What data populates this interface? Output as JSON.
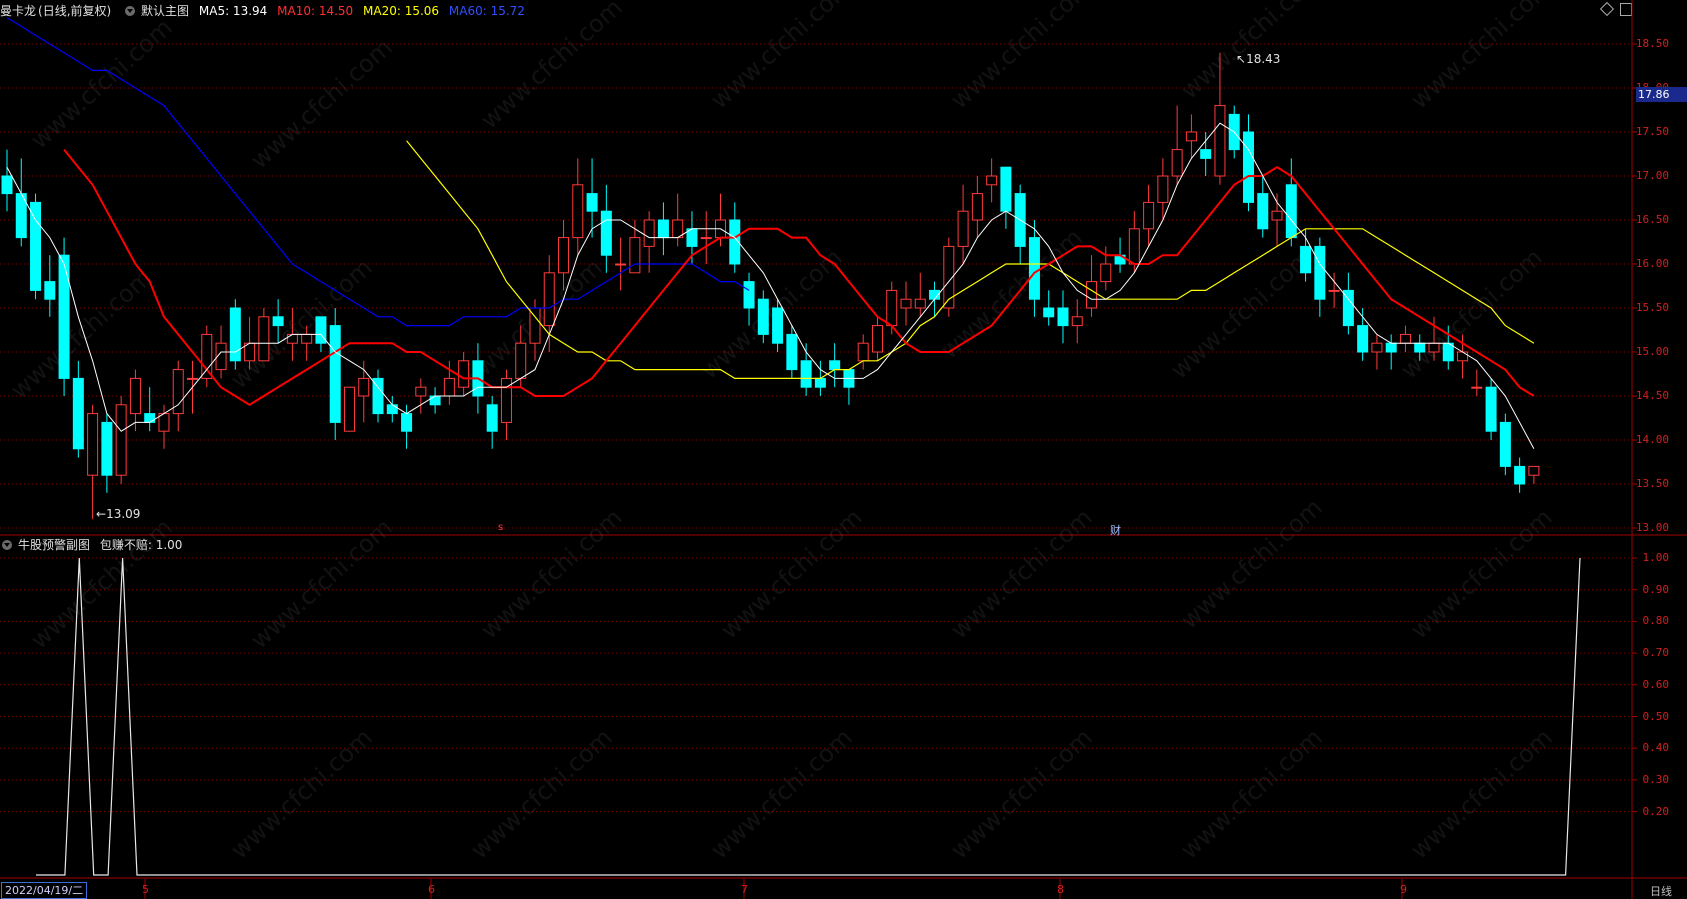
{
  "main_header": {
    "stock_name": "曼卡龙",
    "mode": "(日线,前复权)",
    "template": "默认主图",
    "ma5": "MA5: 13.94",
    "ma10": "MA10: 14.50",
    "ma20": "MA20: 15.06",
    "ma60": "MA60: 15.72"
  },
  "sub_header": {
    "indicator": "牛股预警副图",
    "value": "包赚不赔: 1.00"
  },
  "colors": {
    "up": "#ff3b3b",
    "down": "#00ffff",
    "ma5": "#ffffff",
    "ma10": "#ff0000",
    "ma20": "#ffff00",
    "ma60": "#0000ff",
    "grid": "#7a0000"
  },
  "price_axis": [
    "18.50",
    "18.00",
    "17.50",
    "17.00",
    "16.50",
    "16.00",
    "15.50",
    "15.00",
    "14.50",
    "14.00",
    "13.50",
    "13.00"
  ],
  "current_price": "17.86",
  "indicator_axis": [
    "1.00",
    "0.90",
    "0.80",
    "0.70",
    "0.60",
    "0.50",
    "0.40",
    "0.30",
    "0.20"
  ],
  "annotations": {
    "high": "18.43",
    "low": "13.09"
  },
  "markers": {
    "s": "s",
    "cai": "财"
  },
  "time_axis": {
    "start_date": "2022/04/19/二",
    "months": [
      "5",
      "6",
      "7",
      "8",
      "9"
    ],
    "period": "日线"
  },
  "watermark": "www.cfchi.com",
  "chart_data": [
    {
      "type": "candlestick",
      "title": "曼卡龙 (日线,前复权)",
      "ylim": [
        12.9,
        18.7
      ],
      "candles": [
        [
          17.0,
          16.8,
          17.3,
          16.6
        ],
        [
          16.8,
          16.3,
          17.2,
          16.2
        ],
        [
          16.7,
          15.7,
          16.8,
          15.6
        ],
        [
          15.8,
          15.6,
          16.1,
          15.4
        ],
        [
          16.1,
          14.7,
          16.3,
          14.5
        ],
        [
          14.7,
          13.9,
          14.9,
          13.8
        ],
        [
          13.6,
          14.3,
          14.4,
          13.1
        ],
        [
          14.2,
          13.6,
          14.3,
          13.4
        ],
        [
          13.6,
          14.4,
          14.5,
          13.5
        ],
        [
          14.3,
          14.7,
          14.8,
          14.1
        ],
        [
          14.3,
          14.2,
          14.6,
          14.1
        ],
        [
          14.1,
          14.3,
          14.4,
          13.9
        ],
        [
          14.3,
          14.8,
          14.9,
          14.1
        ],
        [
          14.7,
          14.7,
          14.9,
          14.3
        ],
        [
          14.7,
          15.2,
          15.3,
          14.6
        ],
        [
          14.8,
          15.1,
          15.3,
          14.7
        ],
        [
          15.5,
          14.9,
          15.6,
          14.8
        ],
        [
          14.9,
          15.1,
          15.4,
          14.8
        ],
        [
          14.9,
          15.4,
          15.5,
          14.9
        ],
        [
          15.4,
          15.3,
          15.6,
          15.1
        ],
        [
          15.1,
          15.2,
          15.5,
          14.9
        ],
        [
          15.1,
          15.2,
          15.3,
          14.9
        ],
        [
          15.4,
          15.1,
          15.4,
          15.0
        ],
        [
          15.3,
          14.2,
          15.5,
          14.0
        ],
        [
          14.1,
          14.6,
          14.6,
          14.1
        ],
        [
          14.5,
          14.7,
          14.9,
          14.2
        ],
        [
          14.7,
          14.3,
          14.8,
          14.2
        ],
        [
          14.4,
          14.3,
          14.5,
          14.2
        ],
        [
          14.3,
          14.1,
          14.4,
          13.9
        ],
        [
          14.5,
          14.6,
          14.7,
          14.3
        ],
        [
          14.5,
          14.4,
          14.6,
          14.3
        ],
        [
          14.5,
          14.7,
          14.9,
          14.4
        ],
        [
          14.6,
          14.9,
          15.0,
          14.5
        ],
        [
          14.9,
          14.5,
          15.1,
          14.3
        ],
        [
          14.4,
          14.1,
          14.5,
          13.9
        ],
        [
          14.2,
          14.7,
          14.8,
          14.0
        ],
        [
          14.7,
          15.1,
          15.3,
          14.6
        ],
        [
          15.1,
          15.5,
          15.6,
          14.9
        ],
        [
          15.3,
          15.9,
          16.1,
          15.0
        ],
        [
          15.9,
          16.3,
          16.5,
          15.7
        ],
        [
          16.3,
          16.9,
          17.2,
          16.1
        ],
        [
          16.8,
          16.6,
          17.2,
          16.3
        ],
        [
          16.6,
          16.1,
          16.9,
          15.9
        ],
        [
          16.0,
          16.0,
          16.3,
          15.7
        ],
        [
          15.9,
          16.3,
          16.5,
          15.9
        ],
        [
          16.2,
          16.5,
          16.6,
          15.9
        ],
        [
          16.5,
          16.3,
          16.7,
          16.1
        ],
        [
          16.3,
          16.5,
          16.8,
          16.2
        ],
        [
          16.4,
          16.2,
          16.6,
          16.0
        ],
        [
          16.3,
          16.3,
          16.6,
          16.0
        ],
        [
          16.3,
          16.5,
          16.8,
          16.2
        ],
        [
          16.5,
          16.0,
          16.7,
          15.9
        ],
        [
          15.8,
          15.5,
          15.9,
          15.3
        ],
        [
          15.6,
          15.2,
          15.7,
          15.1
        ],
        [
          15.5,
          15.1,
          15.6,
          15.0
        ],
        [
          15.2,
          14.8,
          15.3,
          14.7
        ],
        [
          14.9,
          14.6,
          15.1,
          14.5
        ],
        [
          14.7,
          14.6,
          14.9,
          14.5
        ],
        [
          14.9,
          14.8,
          15.1,
          14.6
        ],
        [
          14.8,
          14.6,
          14.8,
          14.4
        ],
        [
          14.9,
          15.1,
          15.2,
          14.8
        ],
        [
          15.0,
          15.3,
          15.4,
          14.9
        ],
        [
          15.3,
          15.7,
          15.8,
          15.2
        ],
        [
          15.5,
          15.6,
          15.8,
          15.3
        ],
        [
          15.5,
          15.6,
          15.9,
          15.4
        ],
        [
          15.7,
          15.6,
          15.8,
          15.4
        ],
        [
          15.5,
          16.2,
          16.3,
          15.4
        ],
        [
          16.2,
          16.6,
          16.9,
          16.0
        ],
        [
          16.5,
          16.8,
          17.0,
          16.3
        ],
        [
          16.9,
          17.0,
          17.2,
          16.7
        ],
        [
          17.1,
          16.6,
          17.1,
          16.4
        ],
        [
          16.8,
          16.2,
          16.9,
          16.0
        ],
        [
          16.3,
          15.6,
          16.5,
          15.4
        ],
        [
          15.5,
          15.4,
          15.7,
          15.3
        ],
        [
          15.5,
          15.3,
          15.7,
          15.1
        ],
        [
          15.3,
          15.4,
          15.6,
          15.1
        ],
        [
          15.5,
          15.8,
          16.1,
          15.4
        ],
        [
          15.8,
          16.0,
          16.2,
          15.7
        ],
        [
          16.1,
          16.0,
          16.3,
          15.9
        ],
        [
          16.0,
          16.4,
          16.6,
          15.9
        ],
        [
          16.4,
          16.7,
          16.9,
          16.2
        ],
        [
          16.7,
          17.0,
          17.2,
          16.5
        ],
        [
          17.0,
          17.3,
          17.8,
          16.9
        ],
        [
          17.4,
          17.5,
          17.7,
          17.2
        ],
        [
          17.3,
          17.2,
          17.5,
          17.0
        ],
        [
          17.0,
          17.8,
          18.4,
          16.9
        ],
        [
          17.7,
          17.3,
          17.8,
          17.2
        ],
        [
          17.5,
          16.7,
          17.7,
          16.6
        ],
        [
          16.8,
          16.4,
          17.0,
          16.3
        ],
        [
          16.5,
          16.6,
          16.8,
          16.2
        ],
        [
          16.9,
          16.3,
          17.2,
          16.2
        ],
        [
          16.2,
          15.9,
          16.4,
          15.8
        ],
        [
          16.2,
          15.6,
          16.3,
          15.4
        ],
        [
          15.7,
          15.7,
          15.9,
          15.5
        ],
        [
          15.7,
          15.3,
          15.9,
          15.2
        ],
        [
          15.3,
          15.0,
          15.5,
          14.9
        ],
        [
          15.0,
          15.1,
          15.2,
          14.8
        ],
        [
          15.1,
          15.0,
          15.2,
          14.8
        ],
        [
          15.1,
          15.2,
          15.3,
          15.0
        ],
        [
          15.1,
          15.0,
          15.2,
          14.9
        ],
        [
          15.0,
          15.1,
          15.4,
          14.9
        ],
        [
          15.1,
          14.9,
          15.3,
          14.8
        ],
        [
          14.9,
          15.0,
          15.2,
          14.7
        ],
        [
          14.6,
          14.6,
          14.8,
          14.5
        ],
        [
          14.6,
          14.1,
          14.7,
          14.0
        ],
        [
          14.2,
          13.7,
          14.3,
          13.6
        ],
        [
          13.7,
          13.5,
          13.8,
          13.4
        ],
        [
          13.6,
          13.7,
          13.7,
          13.5
        ]
      ],
      "ma5": [
        17.1,
        16.8,
        16.5,
        16.3,
        16.0,
        15.4,
        14.9,
        14.3,
        14.1,
        14.2,
        14.2,
        14.3,
        14.4,
        14.6,
        14.8,
        15.0,
        15.0,
        15.1,
        15.1,
        15.1,
        15.2,
        15.2,
        15.2,
        15.0,
        14.9,
        14.8,
        14.6,
        14.4,
        14.3,
        14.4,
        14.5,
        14.5,
        14.5,
        14.6,
        14.6,
        14.6,
        14.7,
        14.8,
        15.2,
        15.6,
        16.1,
        16.4,
        16.5,
        16.5,
        16.4,
        16.3,
        16.3,
        16.3,
        16.4,
        16.4,
        16.4,
        16.3,
        16.1,
        15.9,
        15.6,
        15.3,
        15.0,
        14.8,
        14.7,
        14.7,
        14.7,
        14.8,
        15.0,
        15.2,
        15.4,
        15.6,
        15.8,
        16.0,
        16.3,
        16.5,
        16.6,
        16.5,
        16.4,
        16.2,
        15.9,
        15.7,
        15.6,
        15.6,
        15.7,
        15.9,
        16.2,
        16.5,
        16.9,
        17.2,
        17.4,
        17.6,
        17.5,
        17.3,
        17.0,
        16.7,
        16.5,
        16.3,
        16.0,
        15.8,
        15.6,
        15.4,
        15.2,
        15.1,
        15.1,
        15.1,
        15.1,
        15.1,
        15.0,
        14.9,
        14.7,
        14.5,
        14.2,
        13.9
      ],
      "ma10": [
        17.3,
        17.1,
        16.9,
        16.6,
        16.3,
        16.0,
        15.8,
        15.4,
        15.2,
        15.0,
        14.8,
        14.6,
        14.5,
        14.4,
        14.5,
        14.6,
        14.7,
        14.8,
        14.9,
        15.0,
        15.1,
        15.1,
        15.1,
        15.1,
        15.0,
        15.0,
        14.9,
        14.8,
        14.7,
        14.7,
        14.6,
        14.6,
        14.6,
        14.5,
        14.5,
        14.5,
        14.6,
        14.7,
        14.9,
        15.1,
        15.3,
        15.5,
        15.7,
        15.9,
        16.1,
        16.2,
        16.3,
        16.3,
        16.4,
        16.4,
        16.4,
        16.3,
        16.3,
        16.1,
        16.0,
        15.8,
        15.6,
        15.4,
        15.3,
        15.1,
        15.0,
        15.0,
        15.0,
        15.1,
        15.2,
        15.3,
        15.5,
        15.7,
        15.9,
        16.0,
        16.1,
        16.2,
        16.2,
        16.1,
        16.1,
        16.0,
        16.0,
        16.1,
        16.1,
        16.3,
        16.5,
        16.7,
        16.9,
        17.0,
        17.0,
        17.1,
        17.0,
        16.8,
        16.6,
        16.4,
        16.2,
        16.0,
        15.8,
        15.6,
        15.5,
        15.4,
        15.3,
        15.2,
        15.1,
        15.0,
        14.9,
        14.8,
        14.6,
        14.5
      ],
      "ma20": [
        17.4,
        17.2,
        17.0,
        16.8,
        16.6,
        16.4,
        16.1,
        15.8,
        15.6,
        15.4,
        15.2,
        15.1,
        15.0,
        15.0,
        14.9,
        14.9,
        14.8,
        14.8,
        14.8,
        14.8,
        14.8,
        14.8,
        14.8,
        14.7,
        14.7,
        14.7,
        14.7,
        14.7,
        14.7,
        14.7,
        14.8,
        14.8,
        14.9,
        14.9,
        15.0,
        15.1,
        15.3,
        15.4,
        15.6,
        15.7,
        15.8,
        15.9,
        16.0,
        16.0,
        16.0,
        16.0,
        15.9,
        15.8,
        15.7,
        15.6,
        15.6,
        15.6,
        15.6,
        15.6,
        15.6,
        15.7,
        15.7,
        15.8,
        15.9,
        16.0,
        16.1,
        16.2,
        16.3,
        16.4,
        16.4,
        16.4,
        16.4,
        16.4,
        16.3,
        16.2,
        16.1,
        16.0,
        15.9,
        15.8,
        15.7,
        15.6,
        15.5,
        15.3,
        15.2,
        15.1
      ],
      "ma60": [
        18.8,
        18.7,
        18.6,
        18.5,
        18.4,
        18.3,
        18.2,
        18.2,
        18.1,
        18.0,
        17.9,
        17.8,
        17.6,
        17.4,
        17.2,
        17.0,
        16.8,
        16.6,
        16.4,
        16.2,
        16.0,
        15.9,
        15.8,
        15.7,
        15.6,
        15.5,
        15.4,
        15.4,
        15.3,
        15.3,
        15.3,
        15.3,
        15.4,
        15.4,
        15.4,
        15.4,
        15.5,
        15.5,
        15.5,
        15.6,
        15.6,
        15.7,
        15.8,
        15.9,
        16.0,
        16.0,
        16.0,
        16.0,
        16.0,
        15.9,
        15.8,
        15.8,
        15.7
      ]
    },
    {
      "type": "line",
      "title": "牛股预警副图",
      "series": [
        {
          "name": "包赚不赔",
          "values": [
            0,
            0,
            0,
            1,
            0,
            0,
            1,
            0,
            0,
            0,
            0,
            0,
            0,
            0,
            0,
            0,
            0,
            0,
            0,
            0,
            0,
            0,
            0,
            0,
            0,
            0,
            0,
            0,
            0,
            0,
            0,
            0,
            0,
            0,
            0,
            0,
            0,
            0,
            0,
            0,
            0,
            0,
            0,
            0,
            0,
            0,
            0,
            0,
            0,
            0,
            0,
            0,
            0,
            0,
            0,
            0,
            0,
            0,
            0,
            0,
            0,
            0,
            0,
            0,
            0,
            0,
            0,
            0,
            0,
            0,
            0,
            0,
            0,
            0,
            0,
            0,
            0,
            0,
            0,
            0,
            0,
            0,
            0,
            0,
            0,
            0,
            0,
            0,
            0,
            0,
            0,
            0,
            0,
            0,
            0,
            0,
            0,
            0,
            0,
            0,
            0,
            0,
            0,
            0,
            0,
            0,
            0,
            1
          ]
        }
      ],
      "ylim": [
        0,
        1.0
      ]
    }
  ]
}
